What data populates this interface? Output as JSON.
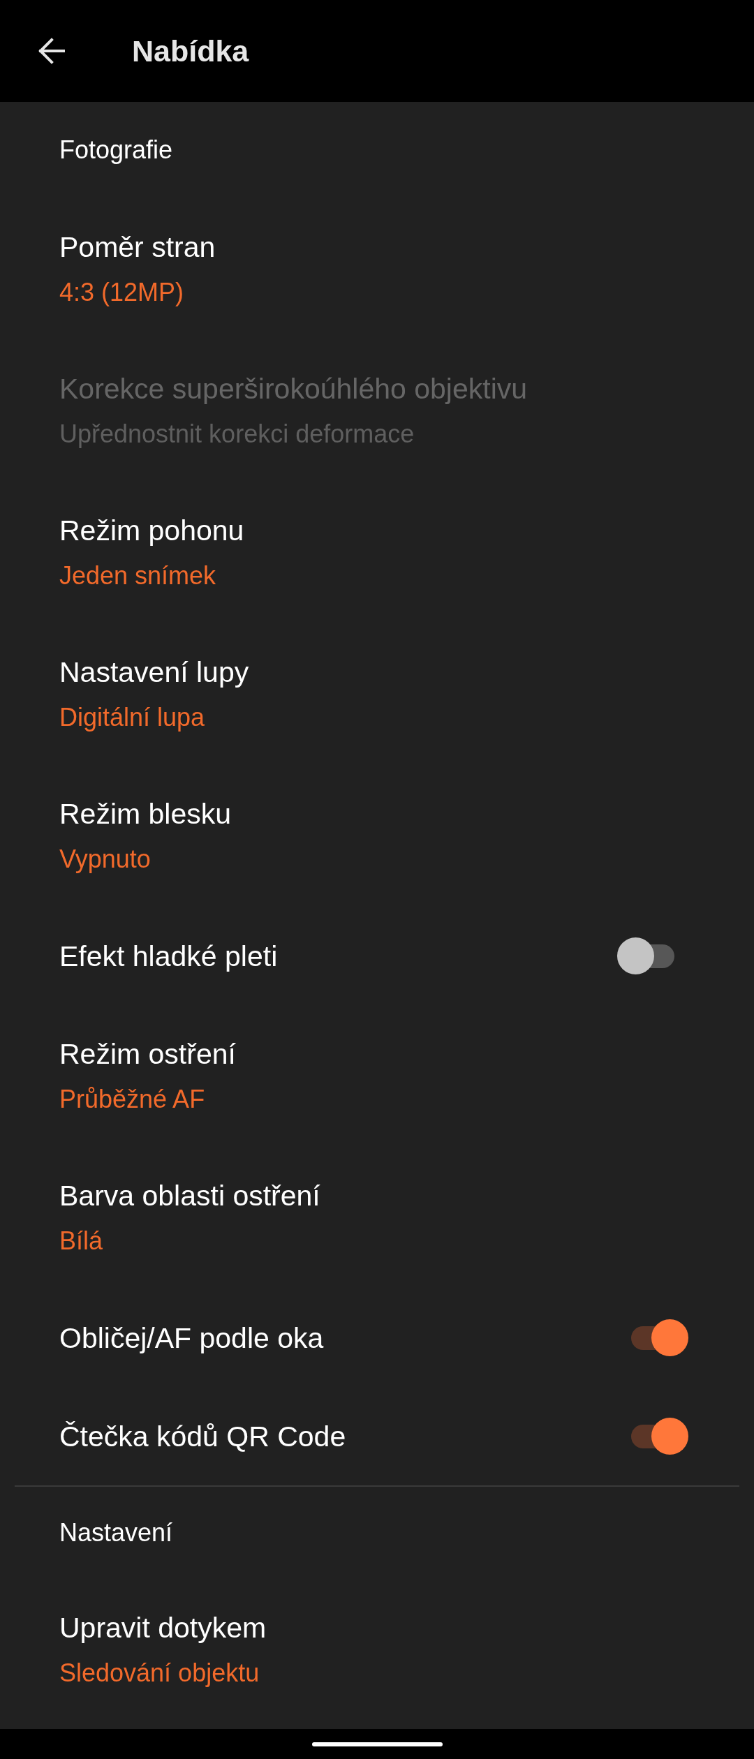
{
  "app_bar": {
    "title": "Nabídka"
  },
  "sections": [
    {
      "title": "Fotografie",
      "items": [
        {
          "kind": "value",
          "title": "Poměr stran",
          "value": "4:3 (12MP)",
          "disabled": false
        },
        {
          "kind": "value",
          "title": "Korekce superširokoúhlého objektivu",
          "value": "Upřednostnit korekci deformace",
          "disabled": true
        },
        {
          "kind": "value",
          "title": "Režim pohonu",
          "value": "Jeden snímek",
          "disabled": false
        },
        {
          "kind": "value",
          "title": "Nastavení lupy",
          "value": "Digitální lupa",
          "disabled": false
        },
        {
          "kind": "value",
          "title": "Režim blesku",
          "value": "Vypnuto",
          "disabled": false
        },
        {
          "kind": "toggle",
          "title": "Efekt hladké pleti",
          "on": false,
          "disabled": false
        },
        {
          "kind": "value",
          "title": "Režim ostření",
          "value": "Průběžné AF",
          "disabled": false
        },
        {
          "kind": "value",
          "title": "Barva oblasti ostření",
          "value": "Bílá",
          "disabled": false
        },
        {
          "kind": "toggle",
          "title": "Obličej/AF podle oka",
          "on": true,
          "disabled": false
        },
        {
          "kind": "toggle",
          "title": "Čtečka kódů QR Code",
          "on": true,
          "disabled": false
        }
      ]
    },
    {
      "title": "Nastavení",
      "items": [
        {
          "kind": "value",
          "title": "Upravit dotykem",
          "value": "Sledování objektu",
          "disabled": false
        }
      ]
    }
  ]
}
